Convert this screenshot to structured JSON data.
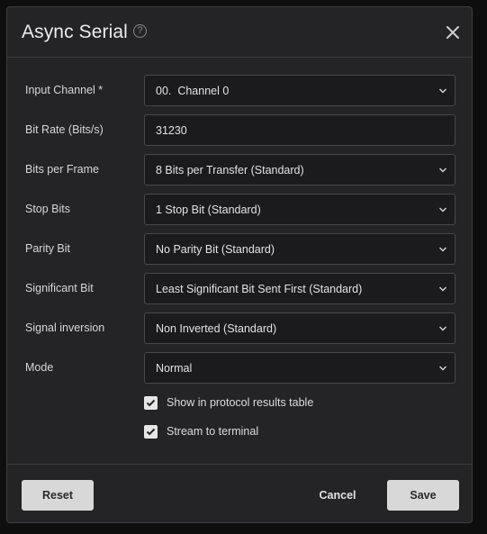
{
  "dialog": {
    "title": "Async Serial",
    "help_icon": "question-circle-icon",
    "close_icon": "close-icon"
  },
  "fields": {
    "input_channel": {
      "label": "Input Channel *",
      "value": "00.  Channel 0"
    },
    "bit_rate": {
      "label": "Bit Rate (Bits/s)",
      "value": "31230"
    },
    "bits_per_frame": {
      "label": "Bits per Frame",
      "value": "8 Bits per Transfer (Standard)"
    },
    "stop_bits": {
      "label": "Stop Bits",
      "value": "1 Stop Bit (Standard)"
    },
    "parity_bit": {
      "label": "Parity Bit",
      "value": "No Parity Bit (Standard)"
    },
    "significant_bit": {
      "label": "Significant Bit",
      "value": "Least Significant Bit Sent First (Standard)"
    },
    "signal_inversion": {
      "label": "Signal inversion",
      "value": "Non Inverted (Standard)"
    },
    "mode": {
      "label": "Mode",
      "value": "Normal"
    }
  },
  "options": {
    "show_in_table": {
      "label": "Show in protocol results table",
      "checked": true
    },
    "stream_to_terminal": {
      "label": "Stream to terminal",
      "checked": true
    }
  },
  "footer": {
    "reset_label": "Reset",
    "cancel_label": "Cancel",
    "save_label": "Save"
  },
  "colors": {
    "background": "#0e0e0e",
    "dialog": "#242426",
    "field": "#1b1b1d",
    "button": "#d8d8d8"
  }
}
